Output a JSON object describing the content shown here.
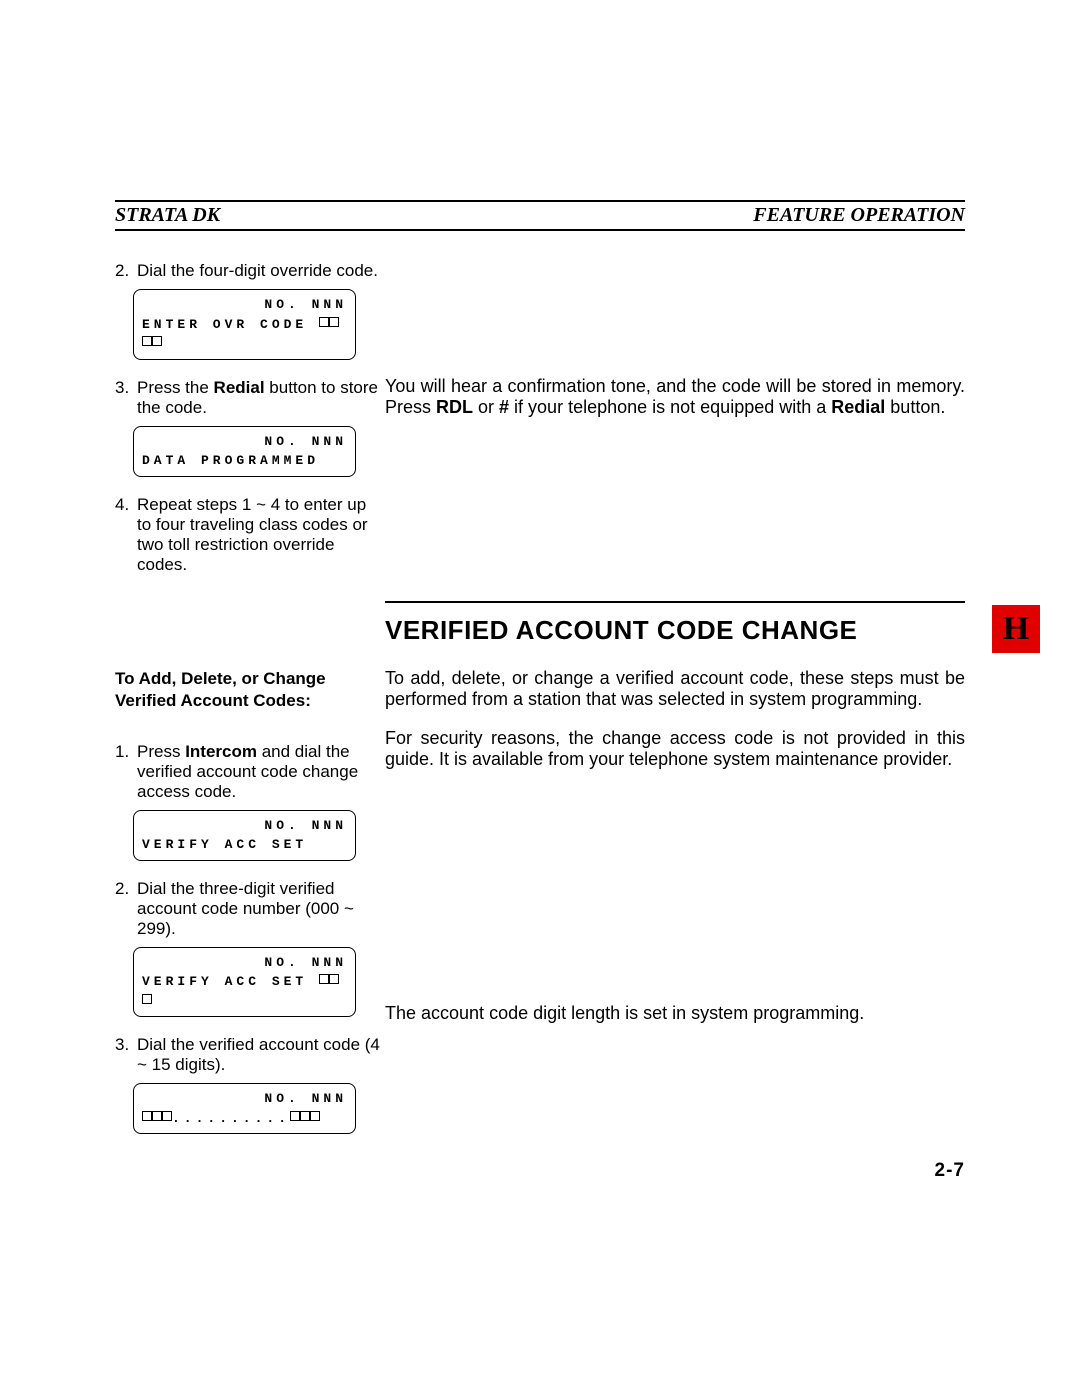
{
  "header": {
    "left": "STRATA DK",
    "right": "FEATURE OPERATION"
  },
  "top_steps": {
    "s2": {
      "n": "2.",
      "text": "Dial the four-digit override code."
    },
    "lcd2": {
      "l1": "NO. NNN",
      "l2": "ENTER OVR CODE "
    },
    "s3": {
      "n": "3.",
      "pre": "Press the ",
      "bold": "Redial",
      "post": " button to store the code."
    },
    "lcd3": {
      "l1": "NO. NNN",
      "l2": "DATA PROGRAMMED"
    },
    "s4": {
      "n": "4.",
      "text": "Repeat steps 1 ~ 4 to enter up to four traveling class codes or two toll restriction override codes."
    }
  },
  "top_right": {
    "p1a": "You will hear a confirmation tone, and the code will be stored in memory. Press ",
    "p1b": "RDL",
    "p1c": " or ",
    "p1d": "#",
    "p1e": " if your telephone is not equipped with a ",
    "p1f": "Redial",
    "p1g": " button."
  },
  "section_title": "VERIFIED ACCOUNT CODE CHANGE",
  "side_heading": "To Add, Delete, or Change Verified Account Codes:",
  "bottom_left": {
    "s1": {
      "n": "1.",
      "pre": "Press ",
      "bold": "Intercom",
      "post": " and dial the verified account code change access code."
    },
    "lcd1": {
      "l1": "NO. NNN",
      "l2": "VERIFY ACC SET"
    },
    "s2": {
      "n": "2.",
      "text": "Dial the three-digit verified account code number (000 ~ 299)."
    },
    "lcd2": {
      "l1": "NO. NNN",
      "l2": "VERIFY ACC SET "
    },
    "s3": {
      "n": "3.",
      "text": "Dial the verified account code (4 ~ 15 digits)."
    },
    "lcd3": {
      "l1": "NO. NNN",
      "l2pre": "",
      "l2post": ".........."
    }
  },
  "bottom_right": {
    "p1": "To add, delete, or change a verified account code, these steps must be performed from a station that was selected in system programming.",
    "p2": "For security reasons, the change access code is not provided in this guide. It is available from your telephone system maintenance provider.",
    "p3": "The account code digit length is set in system programming."
  },
  "tab_letter": "H",
  "page_number": "2-7"
}
